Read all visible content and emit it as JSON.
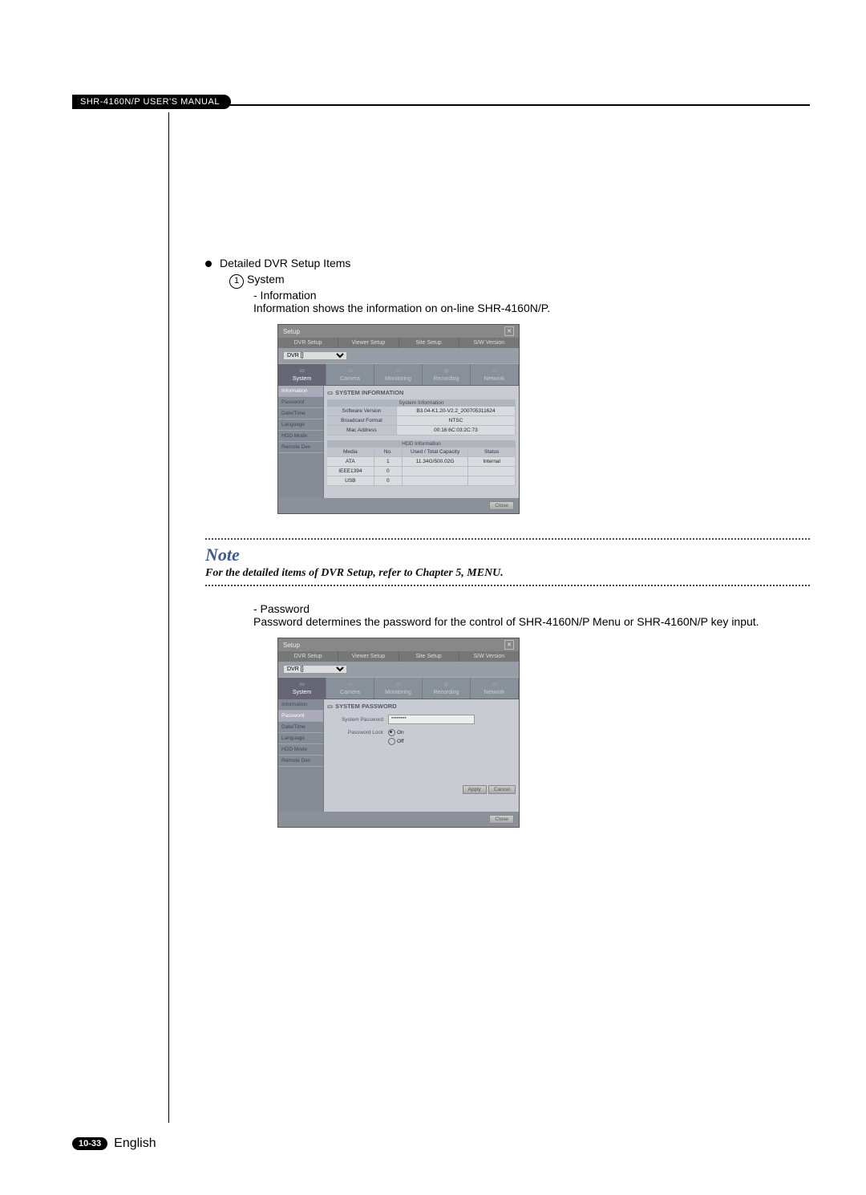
{
  "header": {
    "manual_title": "SHR-4160N/P USER'S MANUAL"
  },
  "section": {
    "bullet_title": "Detailed DVR Setup Items",
    "item1_num": "1",
    "item1_label": "System",
    "info_label": "- Information",
    "info_desc": "Information shows the information on on-line SHR-4160N/P.",
    "pw_label": "- Password",
    "pw_desc": "Password determines the password for the control of SHR-4160N/P Menu or SHR-4160N/P key input."
  },
  "note": {
    "title": "Note",
    "body": "For the detailed items of DVR Setup, refer to Chapter 5, MENU."
  },
  "footer": {
    "page": "10-33",
    "lang": "English"
  },
  "setup_common": {
    "window_title": "Setup",
    "tabs": {
      "dvr": "DVR Setup",
      "viewer": "Viewer Setup",
      "site": "Site Setup",
      "sw": "S/W Version"
    },
    "dvr_select": "DVR []",
    "cats": {
      "system": "System",
      "camera": "Camera",
      "monitoring": "Monitoring",
      "recording": "Recording",
      "network": "Network"
    },
    "side": {
      "information": "Information",
      "password": "Password",
      "datetime": "Date/Time",
      "language": "Language",
      "hddmode": "HDD Mode",
      "remotedev": "Remote Dev"
    },
    "close_btn": "Close"
  },
  "info_panel": {
    "heading": "SYSTEM INFORMATION",
    "sys_head": "System Information",
    "rows": {
      "sw_label": "Software Version",
      "sw_val": "B3.04-K1.20-V2.2_200705311624",
      "bf_label": "Broadcast Format",
      "bf_val": "NTSC",
      "mac_label": "Mac Address",
      "mac_val": "00:16:6C:03:2C:73"
    },
    "hdd_head": "HDD Information",
    "hdd_cols": {
      "media": "Media",
      "no": "No.",
      "cap": "Used / Total Capacity",
      "status": "Status"
    },
    "hdd_rows": [
      {
        "media": "ATA",
        "no": "1",
        "cap": "11.34G/500.02G",
        "status": "Internal"
      },
      {
        "media": "IEEE1394",
        "no": "0",
        "cap": "",
        "status": ""
      },
      {
        "media": "USB",
        "no": "0",
        "cap": "",
        "status": ""
      }
    ]
  },
  "pw_panel": {
    "heading": "SYSTEM PASSWORD",
    "syspw_label": "System Password",
    "syspw_value": "********",
    "lock_label": "Password Lock",
    "opt_on": "On",
    "opt_off": "Off",
    "apply": "Apply",
    "cancel": "Cancel"
  }
}
